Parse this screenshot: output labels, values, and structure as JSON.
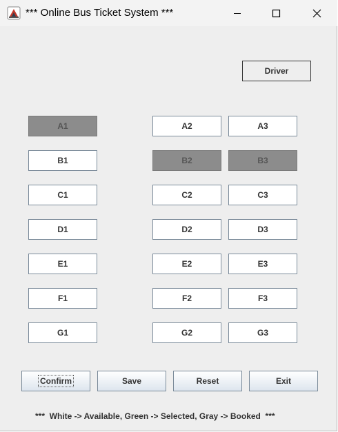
{
  "window": {
    "title": "*** Online Bus Ticket System ***",
    "controls": [
      "minimize",
      "maximize",
      "close"
    ]
  },
  "driver_label": "Driver",
  "seats": {
    "A1": {
      "label": "A1",
      "status": "booked"
    },
    "A2": {
      "label": "A2",
      "status": "available"
    },
    "A3": {
      "label": "A3",
      "status": "available"
    },
    "B1": {
      "label": "B1",
      "status": "available"
    },
    "B2": {
      "label": "B2",
      "status": "booked"
    },
    "B3": {
      "label": "B3",
      "status": "booked"
    },
    "C1": {
      "label": "C1",
      "status": "available"
    },
    "C2": {
      "label": "C2",
      "status": "available"
    },
    "C3": {
      "label": "C3",
      "status": "available"
    },
    "D1": {
      "label": "D1",
      "status": "available"
    },
    "D2": {
      "label": "D2",
      "status": "available"
    },
    "D3": {
      "label": "D3",
      "status": "available"
    },
    "E1": {
      "label": "E1",
      "status": "available"
    },
    "E2": {
      "label": "E2",
      "status": "available"
    },
    "E3": {
      "label": "E3",
      "status": "available"
    },
    "F1": {
      "label": "F1",
      "status": "available"
    },
    "F2": {
      "label": "F2",
      "status": "available"
    },
    "F3": {
      "label": "F3",
      "status": "available"
    },
    "G1": {
      "label": "G1",
      "status": "available"
    },
    "G2": {
      "label": "G2",
      "status": "available"
    },
    "G3": {
      "label": "G3",
      "status": "available"
    }
  },
  "actions": {
    "confirm": "Confirm",
    "save": "Save",
    "reset": "Reset",
    "exit": "Exit"
  },
  "legend": "***  White -> Available, Green -> Selected, Gray -> Booked  ***",
  "colors": {
    "available": "#ffffff",
    "booked": "#8c8c8c",
    "window_bg": "#eeeeee"
  }
}
